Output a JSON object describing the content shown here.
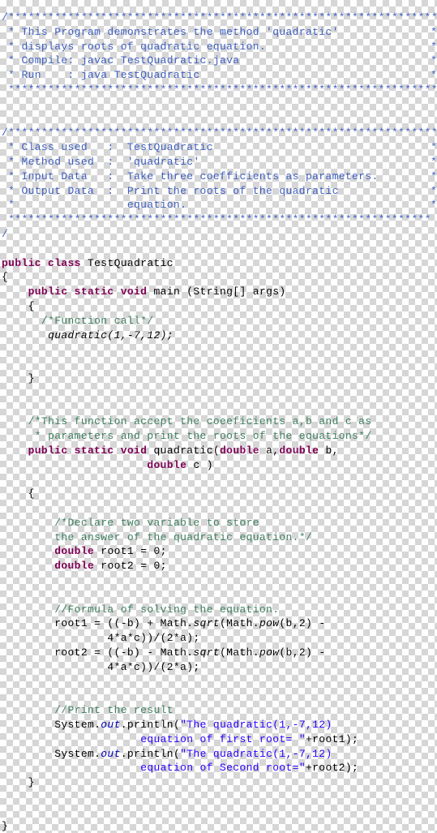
{
  "document": {
    "title": "TestQuadratic.java",
    "language": "Java",
    "background": "transparent-checkerboard",
    "colors": {
      "doc_comment": "#3f5fbf",
      "line_comment": "#3f7f5f",
      "keyword": "#7f0055",
      "string": "#2a00ff",
      "static_field": "#0000c0",
      "plain": "#000000",
      "checker_light": "#ffffff",
      "checker_dark": "#d6d6d6"
    }
  },
  "code": {
    "header_banner_top": "/*******************************************************************",
    "header_lines": [
      {
        "text": " * This Program demonstrates the method 'quadratic'",
        "tail": "*"
      },
      {
        "text": " * displays roots of quadratic equation.",
        "tail": "*"
      },
      {
        "text": " * Compile: javac TestQuadratic.java",
        "tail": "*"
      },
      {
        "text": " * Run    : java TestQuadratic",
        "tail": "*"
      }
    ],
    "header_banner_bottom": " *****************************************************************/",
    "info_banner_top": "/*******************************************************************",
    "info_lines": [
      {
        "text": " * Class used   :  TestQuadratic",
        "tail": "*"
      },
      {
        "text": " * Method used  :  'quadratic'",
        "tail": "*"
      },
      {
        "text": " * Input Data   :  Take three coefficients as parameters.",
        "tail": "*"
      },
      {
        "text": " * Output Data  :  Print the roots of the quadratic",
        "tail": "*"
      },
      {
        "text": " *                 equation.",
        "tail": "*"
      }
    ],
    "info_banner_bottom": " ****************************************************************",
    "info_banner_close": "/",
    "class_decl": {
      "keywords": "public class",
      "name": " TestQuadratic"
    },
    "class_open_brace": "{",
    "main_decl": {
      "keywords": "public static void",
      "rest": " main (String[] args)"
    },
    "main_open_brace": "{",
    "function_call_comment": "/*Function call*/",
    "function_call": "quadratic(1,-7,12);",
    "main_close_brace": "}",
    "method_doc_line1": "/*This function accept the coeeficients a,b and c as",
    "method_doc_line2": " * parameters and print the roots of the equations*/",
    "method_decl": {
      "keywords": "public static void",
      "name": " quadratic(",
      "param1_kw": "double",
      "param1": " a,",
      "param2_kw": "double",
      "param2": " b,",
      "param3_kw": "double",
      "param3": " c )"
    },
    "method_open_brace": "{",
    "declare_comment_line1": "/*Declare two variable to store",
    "declare_comment_line2": "the answer of the quadratic equation.*/",
    "decl_root1_kw": "double",
    "decl_root1": " root1 = 0;",
    "decl_root2_kw": "double",
    "decl_root2": " root2 = 0;",
    "formula_comment": "//Formula of solving the equation.",
    "root1_expr_a": "root1 = ((-b) + Math.",
    "root1_sqrt": "sqrt",
    "root1_expr_b": "(Math.",
    "root1_pow": "pow",
    "root1_expr_c": "(b,2) -",
    "root1_expr_cont": "4*a*c))/(2*a);",
    "root2_expr_a": "root2 = ((-b) - Math.",
    "root2_sqrt": "sqrt",
    "root2_expr_b": "(Math.",
    "root2_pow": "pow",
    "root2_expr_c": "(b,2) -",
    "root2_expr_cont": "4*a*c))/(2*a);",
    "print_comment": "//Print the result",
    "print1_prefix": "System.",
    "print1_out": "out",
    "print1_mid": ".println(",
    "print1_str": "\"The quadratic(1,-7,12)",
    "print1_str_cont": "equation of first root= \"",
    "print1_suffix": "+root1);",
    "print2_prefix": "System.",
    "print2_out": "out",
    "print2_mid": ".println(",
    "print2_str": "\"The quadratic(1,-7,12)",
    "print2_str_cont": "equation of Second root=\"",
    "print2_suffix": "+root2);",
    "method_close_brace": "}",
    "class_close_brace": "}"
  }
}
